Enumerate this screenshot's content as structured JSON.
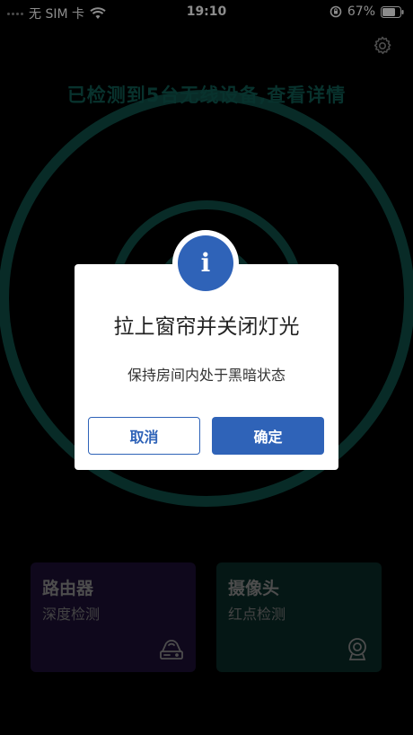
{
  "status_bar": {
    "carrier": "无 SIM 卡",
    "time": "19:10",
    "battery": "67%"
  },
  "header": {
    "detect_text": "已检测到5台无线设备,查看详情"
  },
  "cards": [
    {
      "title": "路由器",
      "subtitle": "深度检测",
      "icon": "router-icon"
    },
    {
      "title": "摄像头",
      "subtitle": "红点检测",
      "icon": "webcam-icon"
    }
  ],
  "dialog": {
    "icon": "info-icon",
    "info_glyph": "i",
    "title": "拉上窗帘并关闭灯光",
    "message": "保持房间内处于黑暗状态",
    "cancel_label": "取消",
    "ok_label": "确定"
  },
  "colors": {
    "accent": "#2f63b8",
    "radar": "#0f5b52",
    "router_card": "#1c1034",
    "camera_card": "#0a2a27"
  }
}
